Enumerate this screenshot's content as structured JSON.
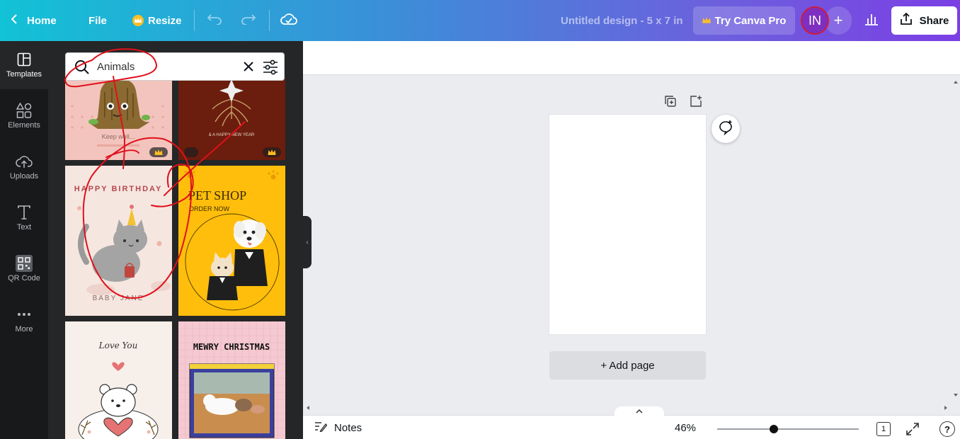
{
  "header": {
    "home_label": "Home",
    "file_label": "File",
    "resize_label": "Resize",
    "doc_title": "Untitled design - 5 x 7 in",
    "try_pro_label": "Try Canva Pro",
    "avatar_initials": "IN",
    "share_label": "Share",
    "gradient_colors": [
      "#12c2d6",
      "#3b8fd8",
      "#6d5fdd",
      "#7b3fe4"
    ]
  },
  "rail": {
    "items": [
      {
        "label": "Templates",
        "icon": "templates-icon"
      },
      {
        "label": "Elements",
        "icon": "elements-icon"
      },
      {
        "label": "Uploads",
        "icon": "upload-cloud-icon"
      },
      {
        "label": "Text",
        "icon": "text-icon"
      },
      {
        "label": "QR Code",
        "icon": "qr-code-icon"
      },
      {
        "label": "More",
        "icon": "more-dots-icon"
      }
    ]
  },
  "panel": {
    "search_value": "Animals",
    "templates": [
      {
        "text": "Keep well...",
        "premium": true
      },
      {
        "text": "& A HAPPY NEW YEAR",
        "premium": true
      },
      {
        "title": "HAPPY BIRTHDAY",
        "subtitle": "BABY JANE",
        "premium": false
      },
      {
        "title": "PET SHOP",
        "subtitle": "ORDER NOW",
        "premium": false
      },
      {
        "title": "Love You",
        "premium": false
      },
      {
        "title": "MEWRY CHRISTMAS",
        "premium": false
      }
    ]
  },
  "canvas": {
    "add_page_label": "+ Add page"
  },
  "footer": {
    "notes_label": "Notes",
    "zoom_label": "46%",
    "zoom_level": 0.46,
    "page_count": "1"
  },
  "annotation_color": "#e0101a"
}
